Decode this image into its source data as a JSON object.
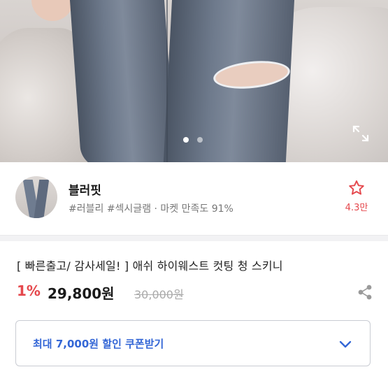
{
  "hero": {
    "image": "product-photo-ripped-jeans",
    "slide_count": 2,
    "active_slide": 1
  },
  "seller": {
    "name": "블러핏",
    "tags": "#러블리 #섹시글램 · 마켓 만족도 91%",
    "favorite_count": "4.3만"
  },
  "product": {
    "title": "[ 빠른출고/ 감사세일! ] 애쉬 하이웨스트 컷팅 청 스키니",
    "discount": "1%",
    "price": "29,800원",
    "original_price": "30,000원"
  },
  "coupon": {
    "label": "최대 7,000원 할인 쿠폰받기"
  },
  "colors": {
    "accent_red": "#e5484d",
    "coupon_blue": "#3366d6"
  }
}
